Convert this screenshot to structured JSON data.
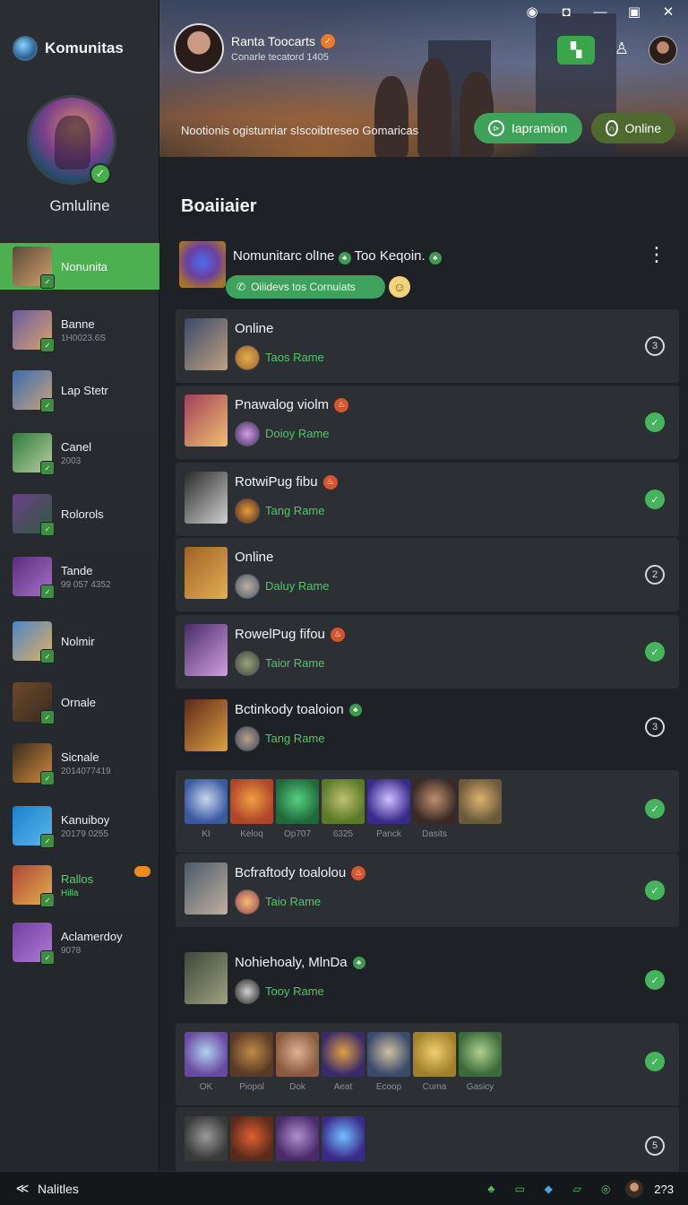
{
  "window": {
    "controls": [
      "◉",
      "◘",
      "—",
      "▣",
      "✕"
    ]
  },
  "brand": {
    "name": "Komunitas"
  },
  "profile": {
    "name": "Gmluline"
  },
  "sidebar": {
    "items": [
      {
        "title": "Nonunita",
        "sub": "",
        "active": true,
        "colors": [
          "#5a4a3a",
          "#d3a26b"
        ]
      },
      {
        "title": "Banne",
        "sub": "1H0023.6S",
        "colors": [
          "#6b5aa0",
          "#d9a36a"
        ]
      },
      {
        "title": "Lap Stetr",
        "sub": "",
        "colors": [
          "#3a6db0",
          "#c9a27a"
        ]
      },
      {
        "title": "Canel",
        "sub": "2003",
        "colors": [
          "#2f7a3a",
          "#b8d0a0"
        ]
      },
      {
        "title": "Rolorols",
        "sub": "",
        "colors": [
          "#6b3f8c",
          "#2e5a3a"
        ]
      },
      {
        "title": "Tande",
        "sub": "99 057 4352",
        "colors": [
          "#5a2f7a",
          "#a66fc9"
        ]
      },
      {
        "title": "Nolmir",
        "sub": "",
        "colors": [
          "#4a86c9",
          "#e0b060"
        ]
      },
      {
        "title": "Ornale",
        "sub": "",
        "colors": [
          "#6b4a2a",
          "#3a2a20"
        ]
      },
      {
        "title": "Sicnale",
        "sub": "2014077419",
        "colors": [
          "#3a2a20",
          "#d08a3a"
        ]
      },
      {
        "title": "Kanuiboy",
        "sub": "20179 0255",
        "colors": [
          "#1d7fc9",
          "#58b8f0"
        ]
      },
      {
        "title": "Rallos",
        "sub": "Hilla",
        "green": true,
        "colors": [
          "#b0453a",
          "#e2b24a"
        ]
      },
      {
        "title": "Aclamerdoy",
        "sub": "9078",
        "colors": [
          "#6f3fa0",
          "#b37ad6"
        ]
      }
    ]
  },
  "header": {
    "user_name": "Ranta Toocarts",
    "user_sub": "Conarle tecatord 1405",
    "banner_text": "Nootionis ogistunriar sIscoibtreseo Gomaricas",
    "import_label": "Iapramion",
    "online_label": "Online"
  },
  "main": {
    "section_title": "Boaiiaier",
    "feature": {
      "title": "Nomunitarc olIne",
      "title_suffix": "Too Keqoin.",
      "pill_label": "Oiiidevs tos Cornuiats"
    },
    "cards": [
      {
        "title": "Online",
        "game": "Taos Rame",
        "status": "pending",
        "status_text": "3",
        "badge": ""
      },
      {
        "title": "Pnawalog violm",
        "game": "Doioy Rame",
        "status": "done",
        "status_text": "✓",
        "badge": "fire"
      },
      {
        "title": "RotwiPug fibu",
        "game": "Tang Rame",
        "status": "done",
        "status_text": "✓",
        "badge": "fire"
      },
      {
        "title": "Online",
        "game": "Daluy Rame",
        "status": "pending",
        "status_text": "2",
        "badge": ""
      },
      {
        "title": "RowelPug fifou",
        "game": "Taior Rame",
        "status": "done",
        "status_text": "✓",
        "badge": "fire"
      },
      {
        "title": "Bctinkody toaloion",
        "game": "Tang Rame",
        "status": "pending",
        "status_text": "3",
        "badge": "leaf"
      },
      {
        "title": "Bcfraftody toalolou",
        "game": "Taio Rame",
        "status": "done",
        "status_text": "✓",
        "badge": "fire"
      },
      {
        "title": "Nohiehoaly, MlnDa",
        "game": "Tooy Rame",
        "status": "done",
        "status_text": "✓",
        "badge": "leaf"
      }
    ],
    "grid1": {
      "items": [
        {
          "label": "KI",
          "colors": [
            "#3a5aa0",
            "#c9d6ee"
          ]
        },
        {
          "label": "Keloq",
          "colors": [
            "#b0452a",
            "#f0a040"
          ]
        },
        {
          "label": "Op707",
          "colors": [
            "#1f6a3a",
            "#58d080"
          ]
        },
        {
          "label": "6325",
          "colors": [
            "#5a7a2a",
            "#c0c070"
          ]
        },
        {
          "label": "Panck",
          "colors": [
            "#3a2a8c",
            "#d0c0ff"
          ]
        },
        {
          "label": "Dasits",
          "colors": [
            "#3a2a25",
            "#c09070"
          ]
        },
        {
          "label": "",
          "colors": [
            "#6a5a3a",
            "#e0b070"
          ]
        }
      ],
      "status_text": "✓"
    },
    "grid2": {
      "items": [
        {
          "label": "OK",
          "colors": [
            "#6a4aa0",
            "#b0d0f0"
          ]
        },
        {
          "label": "Piopol",
          "colors": [
            "#5a3a25",
            "#c08a4a"
          ]
        },
        {
          "label": "Dok",
          "colors": [
            "#8a5a40",
            "#e0b090"
          ]
        },
        {
          "label": "Aeat",
          "colors": [
            "#3a2a6a",
            "#e0a040"
          ]
        },
        {
          "label": "Ecoop",
          "colors": [
            "#3a4a6a",
            "#d0c0a0"
          ]
        },
        {
          "label": "Cuma",
          "colors": [
            "#a0802a",
            "#f0d070"
          ]
        },
        {
          "label": "Gasicy",
          "colors": [
            "#3a6a3a",
            "#b0d090"
          ]
        }
      ],
      "status_text": "✓"
    },
    "grid3": {
      "items": [
        {
          "label": "",
          "colors": [
            "#3a3a3a",
            "#9a9a9a"
          ]
        },
        {
          "label": "",
          "colors": [
            "#5a2a1a",
            "#e06030"
          ]
        },
        {
          "label": "",
          "colors": [
            "#4a2a6a",
            "#b090d0"
          ]
        },
        {
          "label": "",
          "colors": [
            "#3a2a8a",
            "#70c0ff"
          ]
        }
      ],
      "status_text": "5"
    }
  },
  "bottombar": {
    "title": "Nalitles",
    "count": "2?3",
    "icons": [
      "♣",
      "▭",
      "◆",
      "▱",
      "◎"
    ]
  }
}
